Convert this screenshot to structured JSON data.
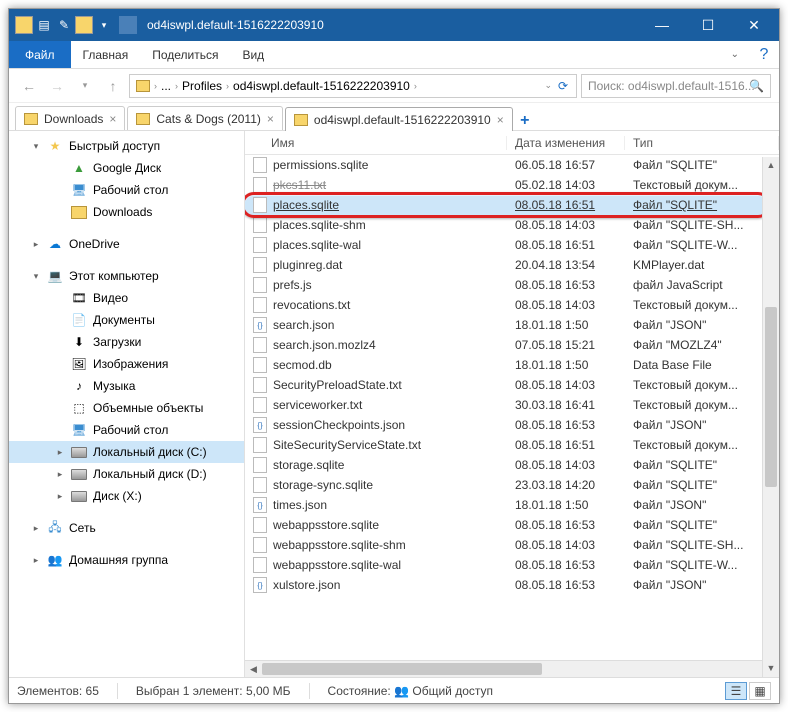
{
  "title": "od4iswpl.default-1516222203910",
  "ribbon": {
    "file": "Файл",
    "tabs": [
      "Главная",
      "Поделиться",
      "Вид"
    ]
  },
  "breadcrumb": [
    "Profiles",
    "od4iswpl.default-1516222203910"
  ],
  "search_placeholder": "Поиск: od4iswpl.default-1516...",
  "tabs": [
    {
      "label": "Downloads"
    },
    {
      "label": "Cats & Dogs (2011)"
    },
    {
      "label": "od4iswpl.default-1516222203910",
      "active": true
    }
  ],
  "sidebar": [
    {
      "type": "node",
      "lvl": 1,
      "icon": "star",
      "tw": "▾",
      "label": "Быстрый доступ"
    },
    {
      "type": "node",
      "lvl": 2,
      "icon": "gdrive",
      "label": "Google Диск"
    },
    {
      "type": "node",
      "lvl": 2,
      "icon": "desktop",
      "label": "Рабочий стол"
    },
    {
      "type": "node",
      "lvl": 2,
      "icon": "folder",
      "label": "Downloads"
    },
    {
      "type": "gap"
    },
    {
      "type": "node",
      "lvl": 1,
      "icon": "onedrive",
      "tw": "▸",
      "label": "OneDrive"
    },
    {
      "type": "gap"
    },
    {
      "type": "node",
      "lvl": 1,
      "icon": "pc",
      "tw": "▾",
      "label": "Этот компьютер"
    },
    {
      "type": "node",
      "lvl": 2,
      "icon": "video",
      "label": "Видео"
    },
    {
      "type": "node",
      "lvl": 2,
      "icon": "docs",
      "label": "Документы"
    },
    {
      "type": "node",
      "lvl": 2,
      "icon": "down",
      "label": "Загрузки"
    },
    {
      "type": "node",
      "lvl": 2,
      "icon": "image",
      "label": "Изображения"
    },
    {
      "type": "node",
      "lvl": 2,
      "icon": "music",
      "label": "Музыка"
    },
    {
      "type": "node",
      "lvl": 2,
      "icon": "cube",
      "label": "Объемные объекты"
    },
    {
      "type": "node",
      "lvl": 2,
      "icon": "desktop",
      "label": "Рабочий стол"
    },
    {
      "type": "node",
      "lvl": 2,
      "icon": "drive",
      "tw": "▸",
      "label": "Локальный диск (C:)",
      "sel": true
    },
    {
      "type": "node",
      "lvl": 2,
      "icon": "drive",
      "tw": "▸",
      "label": "Локальный диск (D:)"
    },
    {
      "type": "node",
      "lvl": 2,
      "icon": "drive",
      "tw": "▸",
      "label": "Диск (X:)"
    },
    {
      "type": "gap"
    },
    {
      "type": "node",
      "lvl": 1,
      "icon": "net",
      "tw": "▸",
      "label": "Сеть"
    },
    {
      "type": "gap"
    },
    {
      "type": "node",
      "lvl": 1,
      "icon": "home",
      "tw": "▸",
      "label": "Домашняя группа"
    }
  ],
  "columns": {
    "name": "Имя",
    "date": "Дата изменения",
    "type": "Тип"
  },
  "files": [
    {
      "n": "permissions.sqlite",
      "d": "06.05.18 16:57",
      "t": "Файл \"SQLITE\"",
      "ic": "file"
    },
    {
      "n": "pkcs11.txt",
      "d": "05.02.18 14:03",
      "t": "Текстовый докум...",
      "ic": "file",
      "strike": true
    },
    {
      "n": "places.sqlite",
      "d": "08.05.18 16:51",
      "t": "Файл \"SQLITE\"",
      "ic": "file",
      "hl": true,
      "u": true
    },
    {
      "n": "places.sqlite-shm",
      "d": "08.05.18 14:03",
      "t": "Файл \"SQLITE-SH...",
      "ic": "file"
    },
    {
      "n": "places.sqlite-wal",
      "d": "08.05.18 16:51",
      "t": "Файл \"SQLITE-W...",
      "ic": "file"
    },
    {
      "n": "pluginreg.dat",
      "d": "20.04.18 13:54",
      "t": "KMPlayer.dat",
      "ic": "file"
    },
    {
      "n": "prefs.js",
      "d": "08.05.18 16:53",
      "t": "файл JavaScript",
      "ic": "file"
    },
    {
      "n": "revocations.txt",
      "d": "08.05.18 14:03",
      "t": "Текстовый докум...",
      "ic": "file"
    },
    {
      "n": "search.json",
      "d": "18.01.18 1:50",
      "t": "Файл \"JSON\"",
      "ic": "json"
    },
    {
      "n": "search.json.mozlz4",
      "d": "07.05.18 15:21",
      "t": "Файл \"MOZLZ4\"",
      "ic": "file"
    },
    {
      "n": "secmod.db",
      "d": "18.01.18 1:50",
      "t": "Data Base File",
      "ic": "file"
    },
    {
      "n": "SecurityPreloadState.txt",
      "d": "08.05.18 14:03",
      "t": "Текстовый докум...",
      "ic": "file"
    },
    {
      "n": "serviceworker.txt",
      "d": "30.03.18 16:41",
      "t": "Текстовый докум...",
      "ic": "file"
    },
    {
      "n": "sessionCheckpoints.json",
      "d": "08.05.18 16:53",
      "t": "Файл \"JSON\"",
      "ic": "json"
    },
    {
      "n": "SiteSecurityServiceState.txt",
      "d": "08.05.18 16:51",
      "t": "Текстовый докум...",
      "ic": "file"
    },
    {
      "n": "storage.sqlite",
      "d": "08.05.18 14:03",
      "t": "Файл \"SQLITE\"",
      "ic": "file"
    },
    {
      "n": "storage-sync.sqlite",
      "d": "23.03.18 14:20",
      "t": "Файл \"SQLITE\"",
      "ic": "file"
    },
    {
      "n": "times.json",
      "d": "18.01.18 1:50",
      "t": "Файл \"JSON\"",
      "ic": "json"
    },
    {
      "n": "webappsstore.sqlite",
      "d": "08.05.18 16:53",
      "t": "Файл \"SQLITE\"",
      "ic": "file"
    },
    {
      "n": "webappsstore.sqlite-shm",
      "d": "08.05.18 14:03",
      "t": "Файл \"SQLITE-SH...",
      "ic": "file"
    },
    {
      "n": "webappsstore.sqlite-wal",
      "d": "08.05.18 16:53",
      "t": "Файл \"SQLITE-W...",
      "ic": "file"
    },
    {
      "n": "xulstore.json",
      "d": "08.05.18 16:53",
      "t": "Файл \"JSON\"",
      "ic": "json"
    }
  ],
  "status": {
    "count_label": "Элементов:",
    "count": "65",
    "sel_label": "Выбран 1 элемент:",
    "sel_size": "5,00 МБ",
    "state_label": "Состояние:",
    "state": "Общий доступ"
  }
}
